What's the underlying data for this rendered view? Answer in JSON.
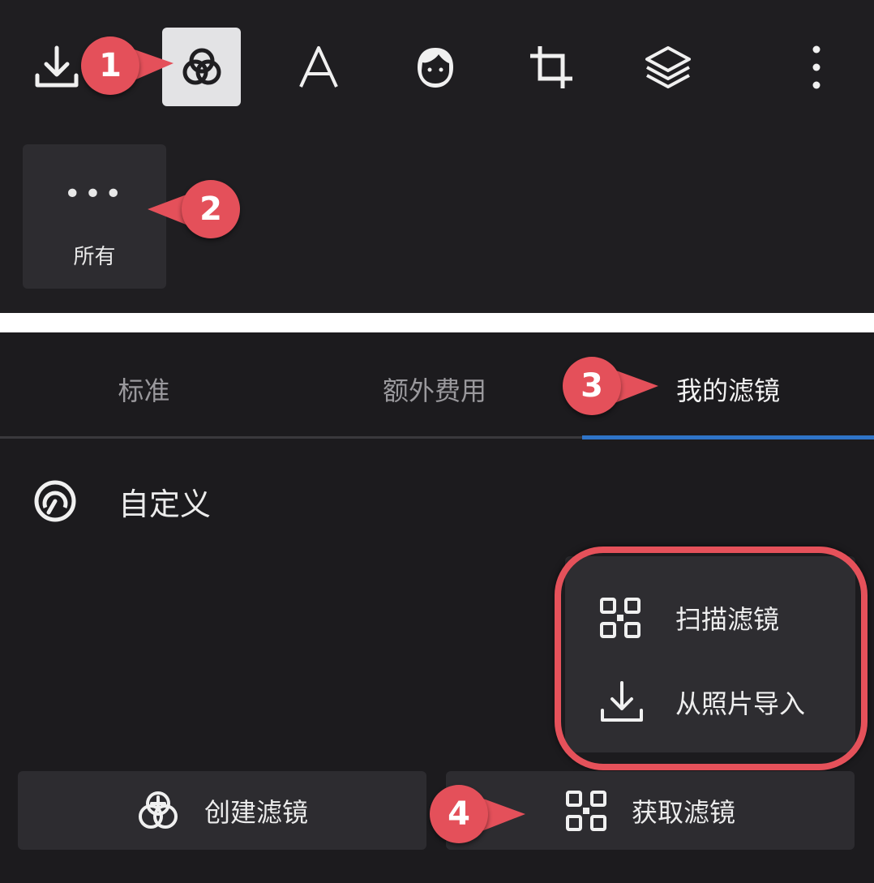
{
  "toolbar": {
    "items": [
      {
        "name": "download-icon"
      },
      {
        "name": "filters-icon",
        "active": true
      },
      {
        "name": "text-icon",
        "glyph": "A"
      },
      {
        "name": "face-icon"
      },
      {
        "name": "crop-icon"
      },
      {
        "name": "layers-icon"
      },
      {
        "name": "more-vertical-icon"
      }
    ]
  },
  "filter_groups": {
    "all_label": "所有",
    "dots": "•••"
  },
  "tabs": [
    {
      "label": "标准"
    },
    {
      "label": "额外费用"
    },
    {
      "label": "我的滤镜",
      "active": true
    }
  ],
  "custom": {
    "label": "自定义"
  },
  "popup": {
    "scan_label": "扫描滤镜",
    "import_label": "从照片导入"
  },
  "buttons": {
    "create_label": "创建滤镜",
    "get_label": "获取滤镜"
  },
  "callouts": {
    "one": "1",
    "two": "2",
    "three": "3",
    "four": "4"
  },
  "colors": {
    "accent_blue": "#2f74c8",
    "callout_red": "#e4505a",
    "panel_bg": "#1f1e21"
  }
}
